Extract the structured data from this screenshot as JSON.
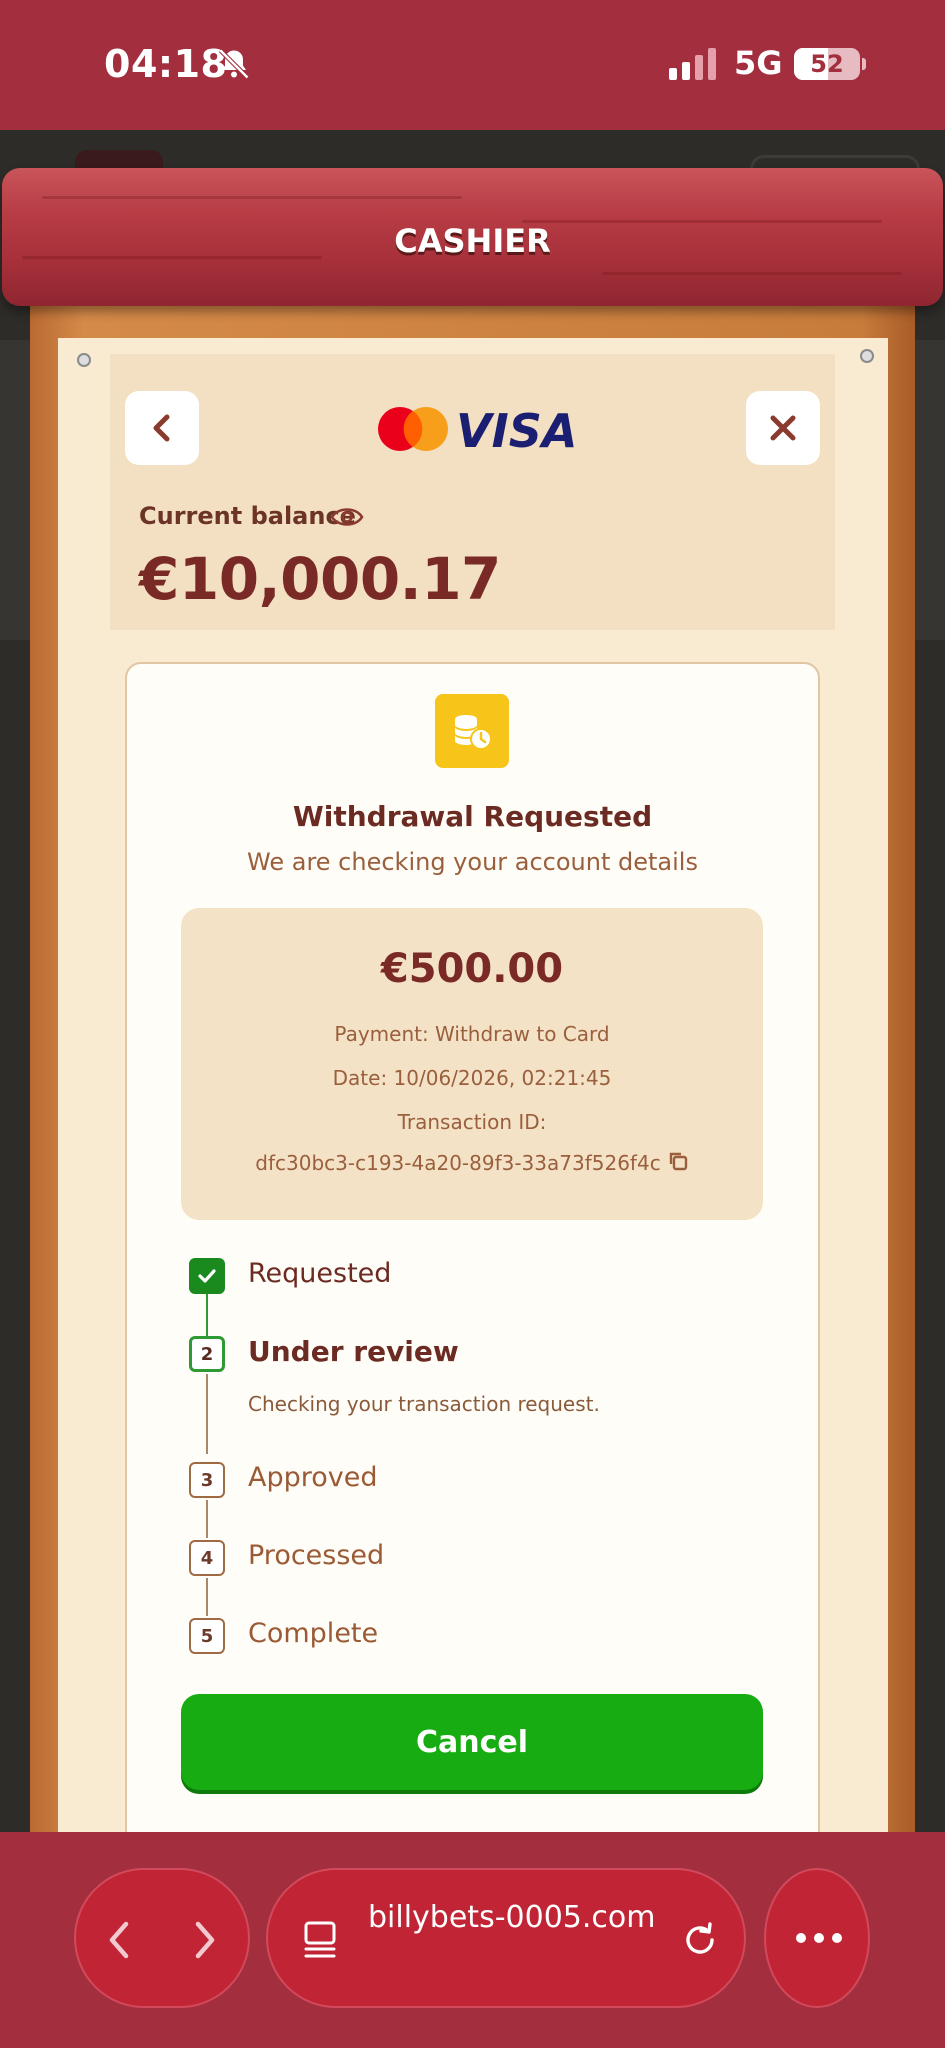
{
  "status_bar": {
    "time": "04:18",
    "network": "5G",
    "battery": "52"
  },
  "header": {
    "title": "CASHIER"
  },
  "cashier": {
    "balance_label": "Current balance",
    "balance_value": "€10,000.17",
    "payment_logos": [
      "mastercard-logo",
      "visa-logo"
    ],
    "visa_text": "VISA"
  },
  "withdrawal": {
    "title": "Withdrawal Requested",
    "subtitle": "We are checking your account details",
    "amount": "€500.00",
    "payment": "Payment: Withdraw to Card",
    "date": "Date: 10/06/2026, 02:21:45",
    "transaction_label": "Transaction ID:",
    "transaction_id": "dfc30bc3-c193-4a20-89f3-33a73f526f4c"
  },
  "steps": [
    {
      "number": "1",
      "label": "Requested",
      "state": "done"
    },
    {
      "number": "2",
      "label": "Under review",
      "state": "current",
      "description": "Checking your transaction request."
    },
    {
      "number": "3",
      "label": "Approved",
      "state": "pending"
    },
    {
      "number": "4",
      "label": "Processed",
      "state": "pending"
    },
    {
      "number": "5",
      "label": "Complete",
      "state": "pending"
    }
  ],
  "actions": {
    "cancel_label": "Cancel"
  },
  "browser": {
    "url": "billybets-0005.com"
  },
  "colors": {
    "brand_red": "#a32e3e",
    "success_green": "#17ad12",
    "text_brown": "#7a2a26",
    "coin_yellow": "#f7c51a"
  }
}
